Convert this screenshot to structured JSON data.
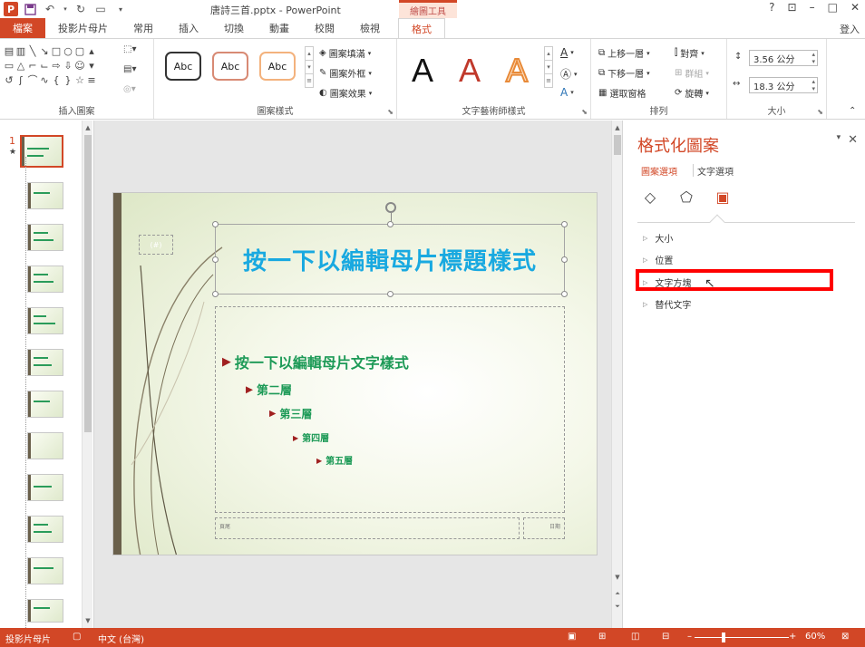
{
  "titlebar": {
    "doc_title": "唐詩三首.pptx - PowerPoint",
    "context_tab_header": "繪圖工具",
    "signin": "登入"
  },
  "tabs": [
    "檔案",
    "投影片母片",
    "常用",
    "插入",
    "切換",
    "動畫",
    "校閱",
    "檢視",
    "格式"
  ],
  "ribbon": {
    "groups": {
      "insert_shapes": "插入圖案",
      "shape_styles": "圖案樣式",
      "wordart_styles": "文字藝術師樣式",
      "arrange": "排列",
      "size": "大小"
    },
    "style_swatches": [
      "Abc",
      "Abc",
      "Abc"
    ],
    "shape_fill": "圖案填滿",
    "shape_outline": "圖案外框",
    "shape_effects": "圖案效果",
    "bring_forward": "上移一層",
    "send_backward": "下移一層",
    "selection_pane": "選取窗格",
    "align": "對齊",
    "group": "群組",
    "rotate": "旋轉",
    "wordart_letters": [
      "A",
      "A",
      "A"
    ],
    "height": "3.56 公分",
    "width": "18.3 公分"
  },
  "thumbnails": {
    "selected_number": "1",
    "star": "★"
  },
  "slide": {
    "title": "按一下以編輯母片標題樣式",
    "date_placeholder": "(#)",
    "bullets": [
      "按一下以編輯母片文字樣式",
      "第二層",
      "第三層",
      "第四層",
      "第五層"
    ],
    "footer_left": "頁尾",
    "footer_right": "日期"
  },
  "pane": {
    "title": "格式化圖案",
    "tab_shape": "圖案選項",
    "tab_text": "文字選項",
    "sections": [
      "大小",
      "位置",
      "文字方塊",
      "替代文字"
    ]
  },
  "status": {
    "view": "投影片母片",
    "language": "中文 (台灣)",
    "zoom": "60%"
  },
  "colors": {
    "accent": "#d24726",
    "title_text": "#19a9e0",
    "body_text": "#1d9a57",
    "highlight": "#ff0000"
  }
}
